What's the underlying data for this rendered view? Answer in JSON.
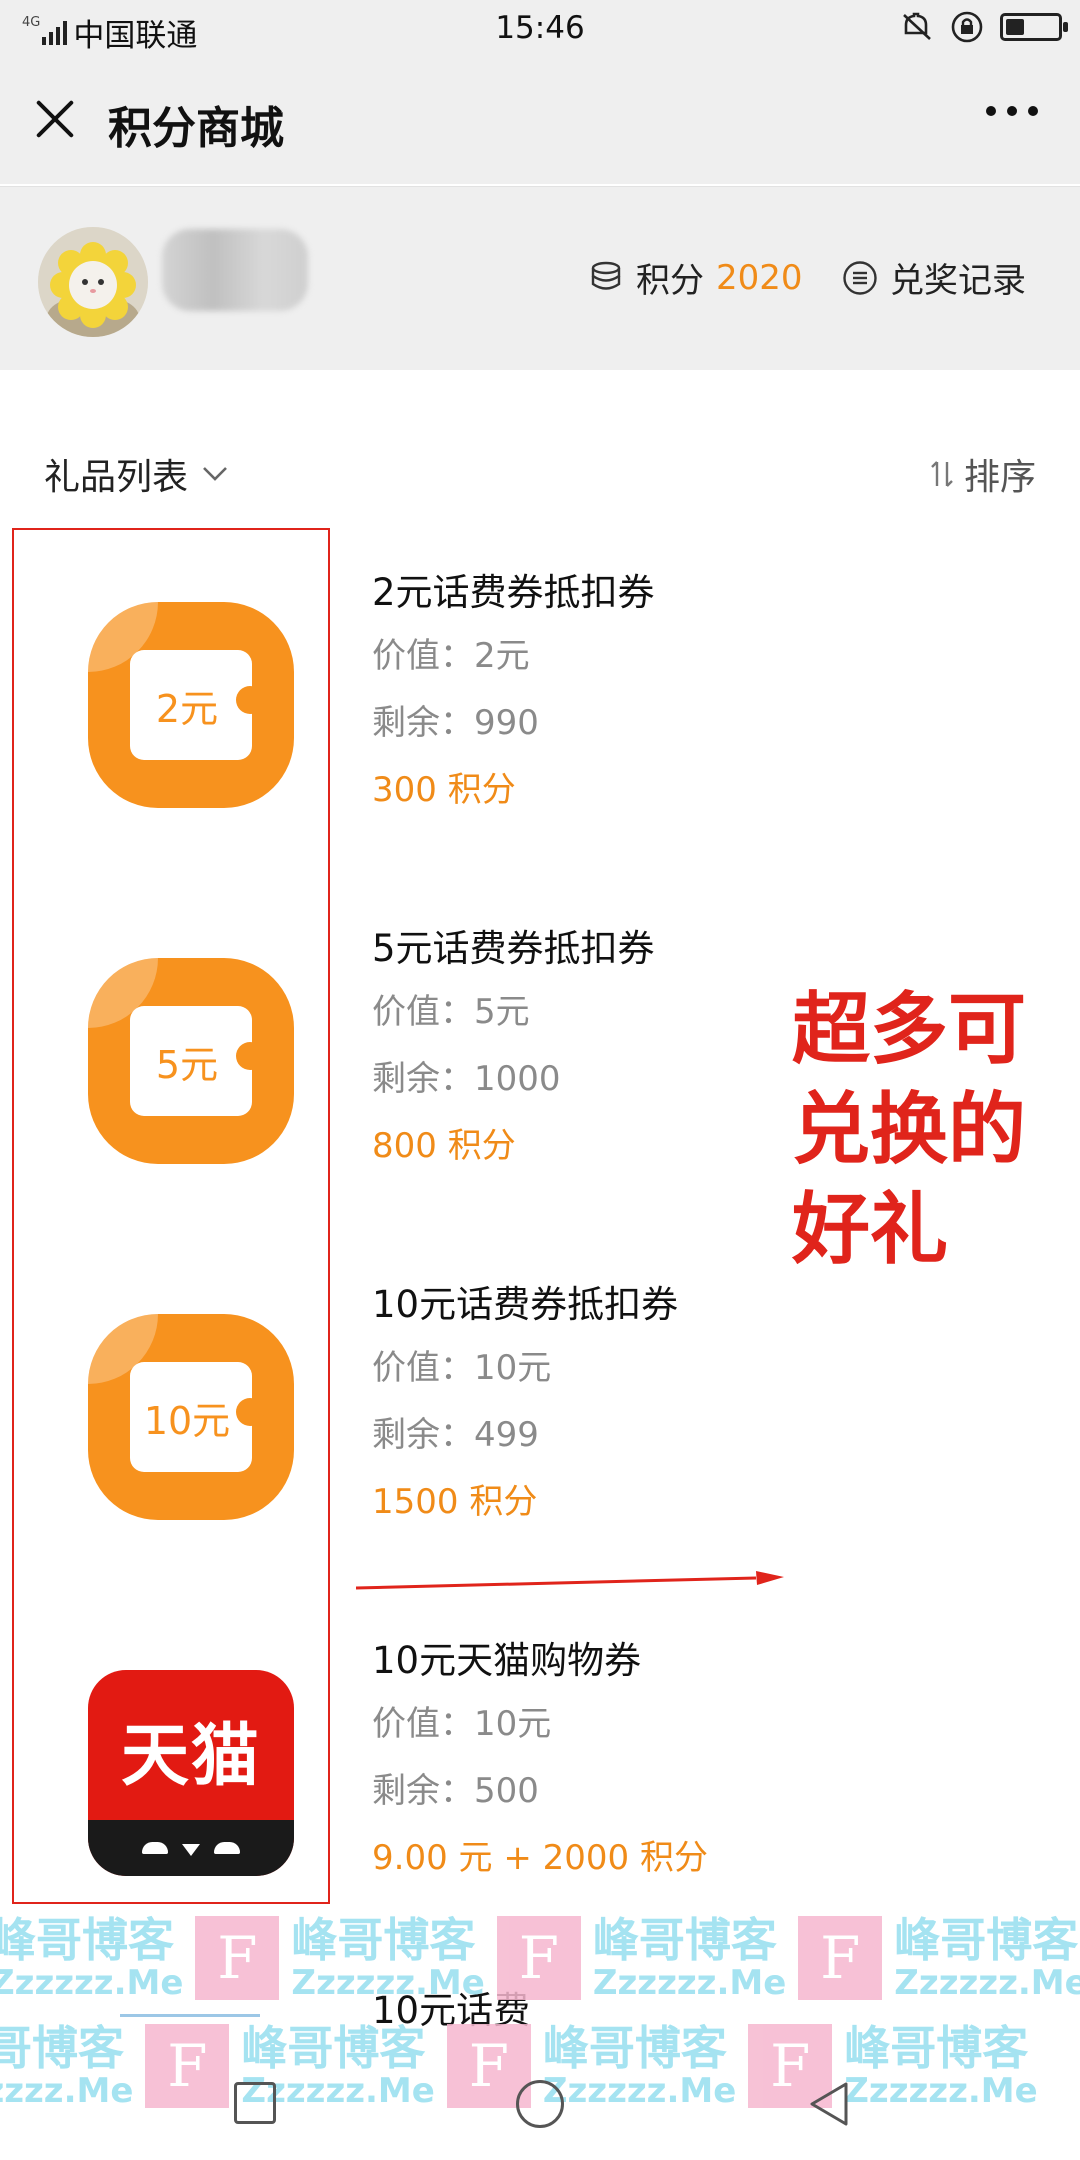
{
  "status_bar": {
    "network": "4G",
    "carrier": "中国联通",
    "time": "15:46",
    "battery_level": 0.35
  },
  "header": {
    "title": "积分商城",
    "close_icon": "close-icon",
    "more_icon": "more-icon"
  },
  "profile": {
    "points_label": "积分",
    "points_value": "2020",
    "records_label": "兑奖记录"
  },
  "list": {
    "title": "礼品列表",
    "sort_label": "排序",
    "items": [
      {
        "name": "2元话费券抵扣券",
        "value": "价值：2元",
        "stock": "剩余：990",
        "price": "300 积分",
        "icon_text": "2元",
        "icon": "coupon-icon"
      },
      {
        "name": "5元话费券抵扣券",
        "value": "价值：5元",
        "stock": "剩余：1000",
        "price": "800 积分",
        "icon_text": "5元",
        "icon": "coupon-icon"
      },
      {
        "name": "10元话费券抵扣券",
        "value": "价值：10元",
        "stock": "剩余：499",
        "price": "1500 积分",
        "icon_text": "10元",
        "icon": "coupon-icon"
      },
      {
        "name": "10元天猫购物券",
        "value": "价值：10元",
        "stock": "剩余：500",
        "price": "9.00 元 + 2000 积分",
        "icon_text": "天猫",
        "icon": "tmall-icon"
      }
    ],
    "next_item_partial": "10元话费"
  },
  "annotation": {
    "line1": "超多可",
    "line2": "兑换的",
    "line3": "好礼"
  },
  "watermark": {
    "logo_letter": "F",
    "text": "峰哥博客",
    "url": "Zzzzzz.Me"
  },
  "colors": {
    "accent_orange": "#f08b18",
    "coupon_orange": "#f7921e",
    "annotation_red": "#e0241b",
    "tmall_red": "#e21a12"
  }
}
